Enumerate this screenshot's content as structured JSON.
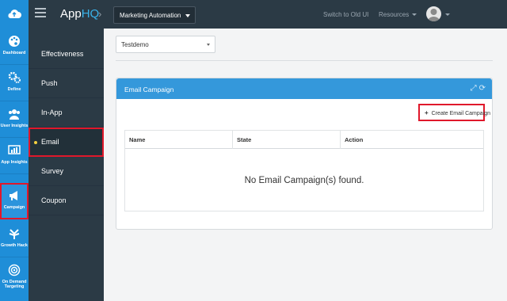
{
  "app": {
    "brand_prefix": "App",
    "brand_suffix": "HQ",
    "selected_app": "Marketing Automation"
  },
  "header": {
    "switch_link": "Switch to Old UI",
    "resources_link": "Resources"
  },
  "iconbar": [
    {
      "label": "Dashboard",
      "icon": "palette-icon"
    },
    {
      "label": "Define",
      "icon": "gears-icon"
    },
    {
      "label": "User Insights",
      "icon": "users-icon"
    },
    {
      "label": "App Insights",
      "icon": "chart-icon"
    },
    {
      "label": "Campaign",
      "icon": "megaphone-icon",
      "active": true
    },
    {
      "label": "Growth Hack",
      "icon": "growth-icon"
    },
    {
      "label": "On Demand Targeting",
      "icon": "target-icon"
    }
  ],
  "subnav": [
    {
      "label": "Effectiveness"
    },
    {
      "label": "Push"
    },
    {
      "label": "In-App"
    },
    {
      "label": "Email",
      "active": true
    },
    {
      "label": "Survey"
    },
    {
      "label": "Coupon"
    }
  ],
  "filter": {
    "value": "Testdemo"
  },
  "panel": {
    "title": "Email Campaign",
    "create_button": "Create Email Campaign",
    "columns": [
      "Name",
      "State",
      "Action"
    ],
    "empty_message": "No Email Campaign(s) found."
  },
  "colors": {
    "accent": "#1f8ed8",
    "header": "#2b3a45",
    "panel_head": "#3498db",
    "highlight": "#e0182b"
  }
}
